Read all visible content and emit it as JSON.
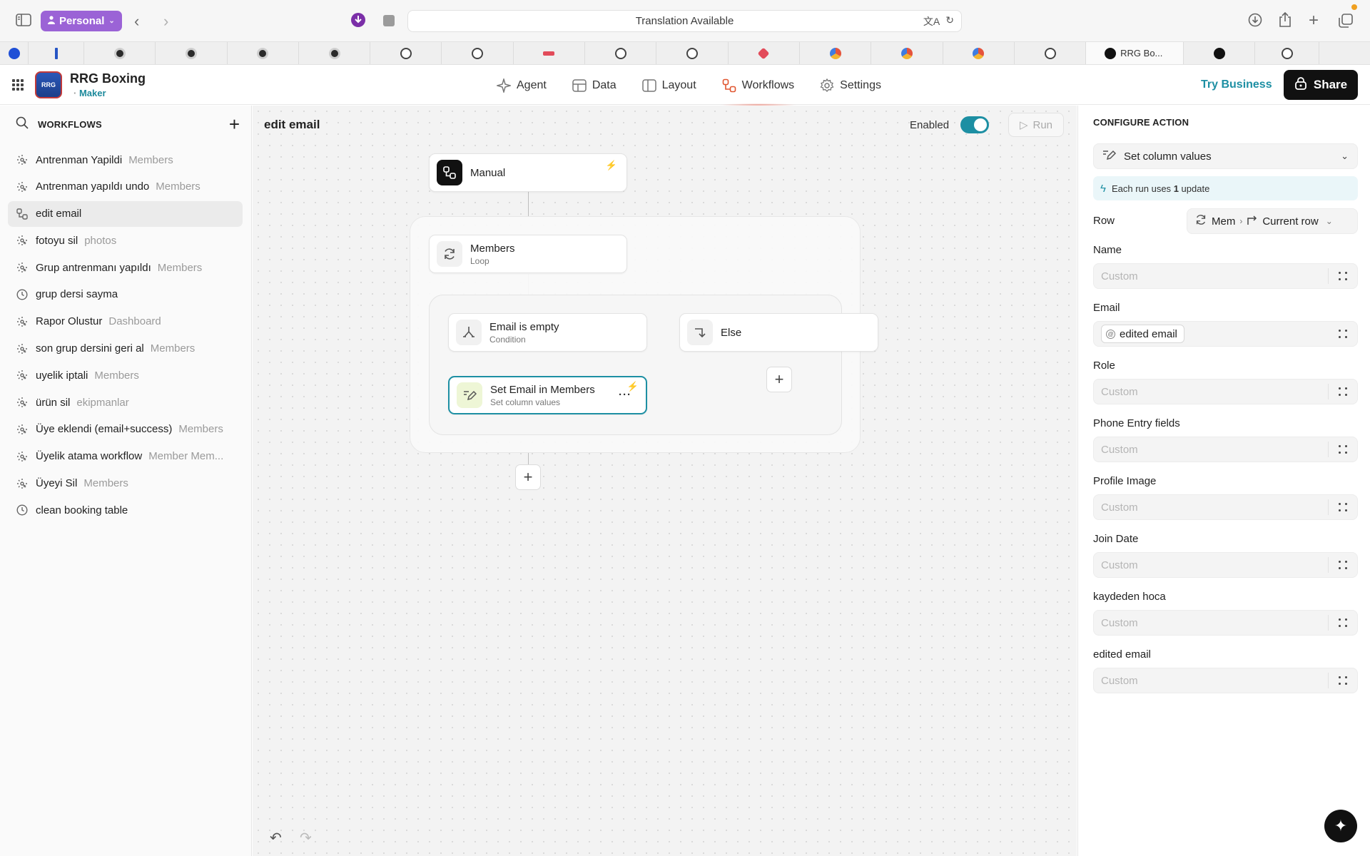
{
  "browser": {
    "profile_label": "Personal",
    "address_text": "Translation Available",
    "active_tab_label": "RRG Bo..."
  },
  "app": {
    "name": "RRG Boxing",
    "role": "Maker",
    "logo_text": "RRG"
  },
  "nav": [
    {
      "label": "Agent",
      "icon": "agent-icon"
    },
    {
      "label": "Data",
      "icon": "table-icon"
    },
    {
      "label": "Layout",
      "icon": "layout-icon"
    },
    {
      "label": "Workflows",
      "icon": "workflow-icon"
    },
    {
      "label": "Settings",
      "icon": "gear-icon"
    }
  ],
  "header": {
    "try_business": "Try Business",
    "share_label": "Share"
  },
  "sidebar": {
    "title": "WORKFLOWS",
    "items": [
      {
        "name": "Antrenman Yapildi",
        "source": "Members",
        "icon": "trigger-icon"
      },
      {
        "name": "Antrenman yapıldı undo",
        "source": "Members",
        "icon": "trigger-icon"
      },
      {
        "name": "edit email",
        "source": "",
        "icon": "manual-icon"
      },
      {
        "name": "fotoyu sil",
        "source": "photos",
        "icon": "trigger-icon"
      },
      {
        "name": "Grup antrenmanı yapıldı",
        "source": "Members",
        "icon": "trigger-icon"
      },
      {
        "name": "grup dersi sayma",
        "source": "",
        "icon": "clock-icon"
      },
      {
        "name": "Rapor Olustur",
        "source": "Dashboard",
        "icon": "trigger-icon"
      },
      {
        "name": "son grup dersini geri al",
        "source": "Members",
        "icon": "trigger-icon"
      },
      {
        "name": "uyelik iptali",
        "source": "Members",
        "icon": "trigger-icon"
      },
      {
        "name": "ürün sil",
        "source": "ekipmanlar",
        "icon": "trigger-icon"
      },
      {
        "name": "Üye eklendi (email+success)",
        "source": "Members",
        "icon": "trigger-icon"
      },
      {
        "name": "Üyelik atama workflow",
        "source": "Member Mem...",
        "icon": "trigger-icon"
      },
      {
        "name": "Üyeyi Sil",
        "source": "Members",
        "icon": "trigger-icon"
      },
      {
        "name": "clean booking table",
        "source": "",
        "icon": "clock-icon"
      }
    ]
  },
  "canvas": {
    "title": "edit email",
    "enabled_label": "Enabled",
    "enabled": true,
    "run_label": "Run",
    "nodes": {
      "trigger": {
        "title": "Manual",
        "sub": ""
      },
      "loop": {
        "title": "Members",
        "sub": "Loop"
      },
      "condition": {
        "title": "Email is empty",
        "sub": "Condition"
      },
      "else": {
        "title": "Else",
        "sub": ""
      },
      "action": {
        "title": "Set Email in Members",
        "sub": "Set column values"
      }
    }
  },
  "panel": {
    "title": "CONFIGURE ACTION",
    "action_type": "Set column values",
    "usage_prefix": "Each run uses",
    "usage_count": "1",
    "usage_suffix": "update",
    "row_label": "Row",
    "row_source": "Mem",
    "row_value": "Current row",
    "fields": [
      {
        "label": "Name",
        "value": "",
        "placeholder": "Custom"
      },
      {
        "label": "Email",
        "value": "edited email",
        "placeholder": "Custom"
      },
      {
        "label": "Role",
        "value": "",
        "placeholder": "Custom"
      },
      {
        "label": "Phone Entry fields",
        "value": "",
        "placeholder": "Custom"
      },
      {
        "label": "Profile Image",
        "value": "",
        "placeholder": "Custom"
      },
      {
        "label": "Join Date",
        "value": "",
        "placeholder": "Custom"
      },
      {
        "label": "kaydeden hoca",
        "value": "",
        "placeholder": "Custom"
      },
      {
        "label": "edited email",
        "value": "",
        "placeholder": "Custom"
      }
    ]
  },
  "colors": {
    "accent": "#1d8fa3",
    "workflows_accent": "#e0552f",
    "profile": "#9b63d6"
  }
}
